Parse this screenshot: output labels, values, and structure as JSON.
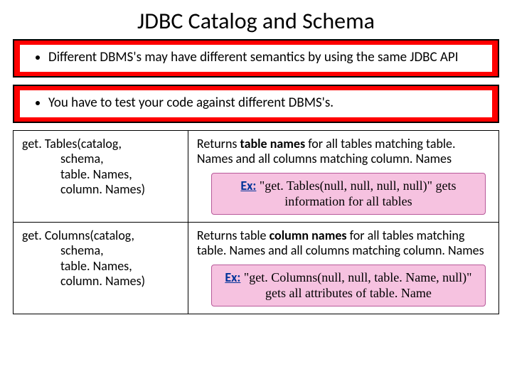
{
  "title": "JDBC Catalog and Schema",
  "bullets": {
    "b1": "Different DBMS's may have different semantics by using the same JDBC API",
    "b2": "You have to test your code against different DBMS's."
  },
  "rows": [
    {
      "sig_head": "get. Tables(catalog,",
      "sig_l2": "schema,",
      "sig_l3": "table. Names,",
      "sig_l4": "column. Names)",
      "desc_pre": "Returns ",
      "desc_bold": "table names",
      "desc_post": " for all tables matching table. Names and all columns matching column. Names",
      "ex_label": "Ex:",
      "ex_quote": " \"get. Tables(null, null, null, null)\" gets information for all tables"
    },
    {
      "sig_head": "get. Columns(catalog,",
      "sig_l2": "schema,",
      "sig_l3": "table. Names,",
      "sig_l4": "column. Names)",
      "desc_pre": "Returns table ",
      "desc_bold": "column names",
      "desc_post": " for all tables matching table. Names and all columns matching column. Names",
      "ex_label": "Ex:",
      "ex_quote": " \"get. Columns(null, null, table. Name, null)\" gets all attributes of table. Name"
    }
  ]
}
